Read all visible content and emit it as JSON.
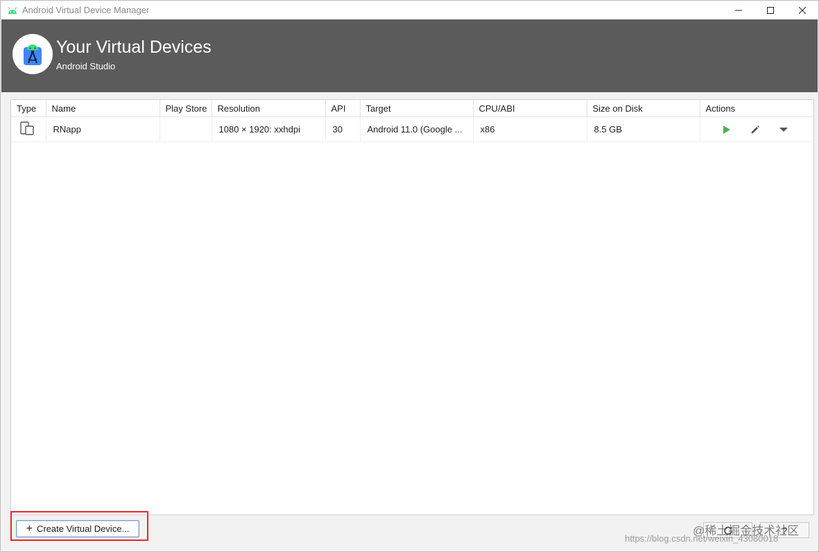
{
  "window": {
    "title": "Android Virtual Device Manager",
    "controls": {
      "minimize": "—",
      "maximize": "☐",
      "close": "✕"
    }
  },
  "header": {
    "title": "Your Virtual Devices",
    "subtitle": "Android Studio",
    "logo_icon": "android-studio-logo-icon"
  },
  "table": {
    "columns": [
      "Type",
      "Name",
      "Play Store",
      "Resolution",
      "API",
      "Target",
      "CPU/ABI",
      "Size on Disk",
      "Actions"
    ],
    "rows": [
      {
        "type_icon": "device-phone-tablet-icon",
        "name": "RNapp",
        "play_store": "",
        "resolution": "1080 × 1920: xxhdpi",
        "api": "30",
        "target": "Android 11.0 (Google ...",
        "cpu_abi": "x86",
        "size_on_disk": "8.5 GB",
        "actions": [
          "play-icon",
          "edit-pencil-icon",
          "dropdown-arrow-icon"
        ]
      }
    ]
  },
  "footer": {
    "create_button_label": "Create Virtual Device...",
    "create_button_icon": "+",
    "help_label": "?"
  },
  "watermark": {
    "text": "@稀土掘金技术社区",
    "url": "https://blog.csdn.net/weixin_43080018"
  },
  "colors": {
    "header_bg": "#5b5b5b",
    "play_green": "#4caf50",
    "highlight_red": "#e42a2a",
    "android_green": "#3ddc84",
    "studio_blue": "#4285f4"
  }
}
